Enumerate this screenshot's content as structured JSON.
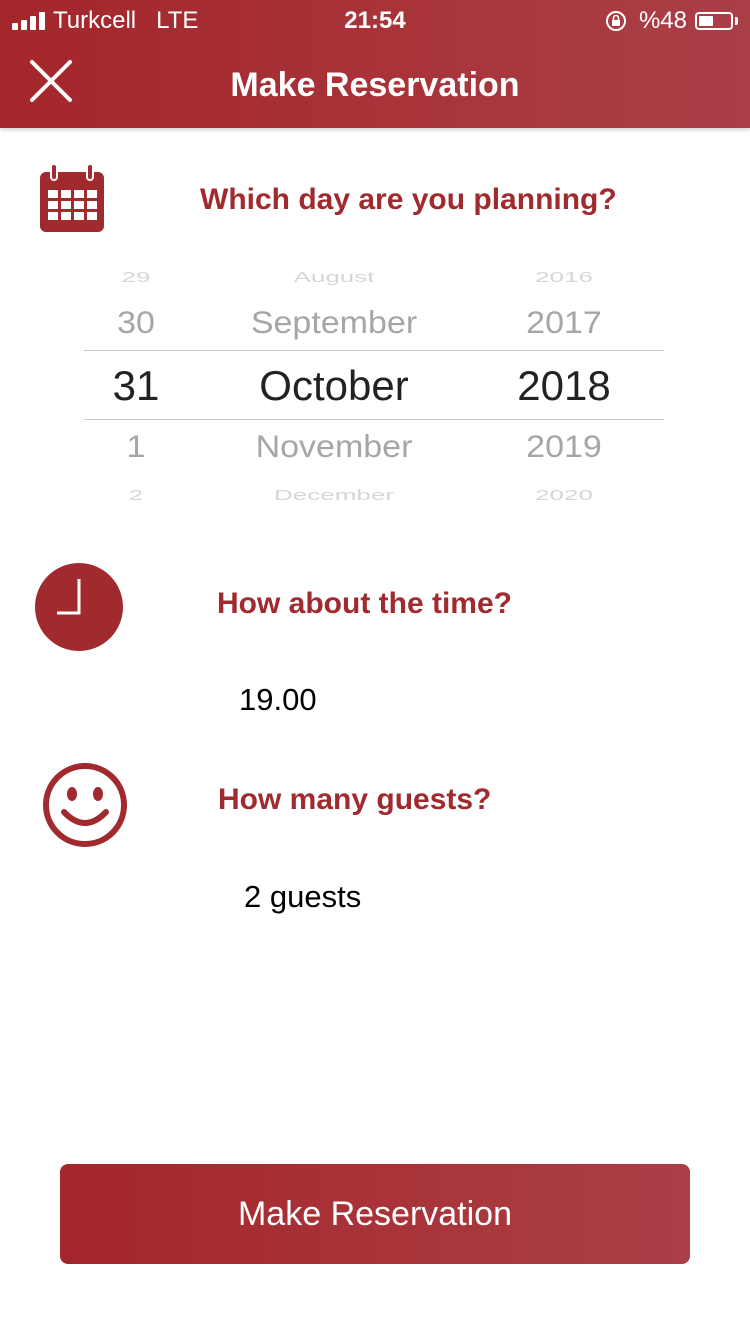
{
  "status_bar": {
    "carrier": "Turkcell",
    "network": "LTE",
    "time": "21:54",
    "battery_text": "%48",
    "battery_level": 0.48,
    "signal_bars": 4
  },
  "header": {
    "title": "Make Reservation",
    "close_icon": "close-icon",
    "colors": {
      "primary": "#a3262a",
      "text": "#ffffff"
    }
  },
  "date_section": {
    "icon": "calendar-icon",
    "question": "Which day are you planning?",
    "picker": {
      "days": [
        "29",
        "30",
        "31",
        "1",
        "2"
      ],
      "months": [
        "August",
        "September",
        "October",
        "November",
        "December"
      ],
      "years": [
        "2016",
        "2017",
        "2018",
        "2019",
        "2020"
      ],
      "selected": {
        "day": "31",
        "month": "October",
        "year": "2018"
      }
    }
  },
  "time_section": {
    "icon": "clock-icon",
    "question": "How about the time?",
    "value": "19.00"
  },
  "guests_section": {
    "icon": "smiley-icon",
    "question": "How many guests?",
    "value": "2 guests"
  },
  "submit_button": {
    "label": "Make Reservation"
  },
  "accent_color": "#a02a2e"
}
